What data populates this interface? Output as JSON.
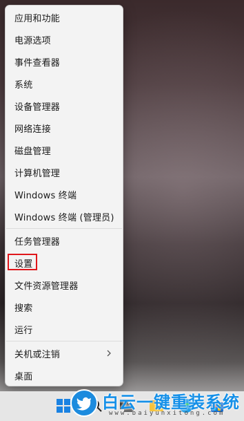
{
  "context_menu": {
    "items": [
      {
        "label": "应用和功能"
      },
      {
        "label": "电源选项"
      },
      {
        "label": "事件查看器"
      },
      {
        "label": "系统"
      },
      {
        "label": "设备管理器"
      },
      {
        "label": "网络连接"
      },
      {
        "label": "磁盘管理"
      },
      {
        "label": "计算机管理"
      },
      {
        "label": "Windows 终端"
      },
      {
        "label": "Windows 终端 (管理员)"
      },
      {
        "label": "任务管理器"
      },
      {
        "label": "设置",
        "highlighted": true,
        "highlight_color": "#e0161b"
      },
      {
        "label": "文件资源管理器"
      },
      {
        "label": "搜索"
      },
      {
        "label": "运行"
      },
      {
        "label": "关机或注销",
        "has_submenu": true,
        "submenu_icon": "chevron-right-icon"
      },
      {
        "label": "桌面"
      }
    ]
  },
  "watermark": {
    "title": "白云一键重装系统",
    "url": "www.baiyunxitong.com",
    "logo_icon": "twitter-bird-icon",
    "color": "#1590e8"
  },
  "taskbar": {
    "icons": [
      "windows-start-icon",
      "search-icon",
      "taskview-icon",
      "file-explorer-icon",
      "edge-icon",
      "store-icon"
    ]
  }
}
